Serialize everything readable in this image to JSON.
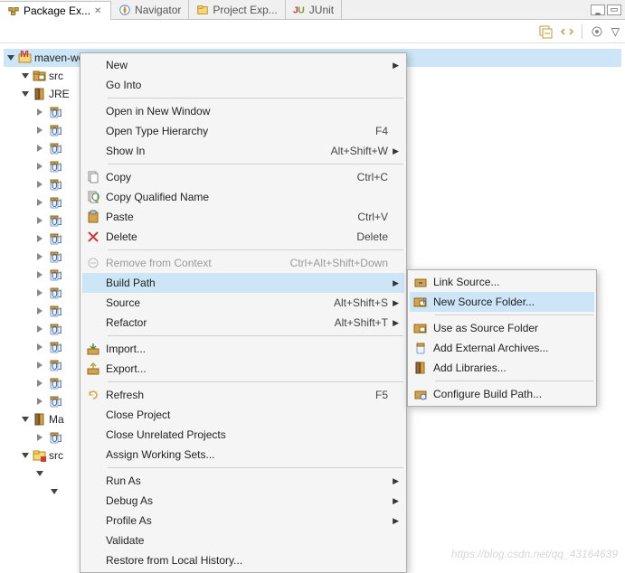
{
  "tabs": [
    {
      "label": "Package Ex...",
      "active": true
    },
    {
      "label": "Navigator",
      "active": false
    },
    {
      "label": "Project Exp...",
      "active": false
    },
    {
      "label": "JUnit",
      "active": false
    }
  ],
  "tree": {
    "root": {
      "label": "maven-web"
    },
    "folder1": {
      "label": "src"
    },
    "folder2": {
      "label": "JRE"
    },
    "mavdep": {
      "label": "Ma"
    },
    "srcfold": {
      "label": "src"
    }
  },
  "context_menu": {
    "items": [
      {
        "label": "New",
        "submenu": true
      },
      {
        "label": "Go Into"
      },
      {
        "sep": true
      },
      {
        "label": "Open in New Window"
      },
      {
        "label": "Open Type Hierarchy",
        "accel": "F4"
      },
      {
        "label": "Show In",
        "accel": "Alt+Shift+W",
        "submenu": true
      },
      {
        "sep": true
      },
      {
        "label": "Copy",
        "accel": "Ctrl+C",
        "icon": "copy"
      },
      {
        "label": "Copy Qualified Name",
        "icon": "copyq"
      },
      {
        "label": "Paste",
        "accel": "Ctrl+V",
        "icon": "paste"
      },
      {
        "label": "Delete",
        "accel": "Delete",
        "icon": "delete"
      },
      {
        "sep": true
      },
      {
        "label": "Remove from Context",
        "accel": "Ctrl+Alt+Shift+Down",
        "disabled": true,
        "icon": "remove"
      },
      {
        "label": "Build Path",
        "submenu": true,
        "selected": true
      },
      {
        "label": "Source",
        "accel": "Alt+Shift+S",
        "submenu": true
      },
      {
        "label": "Refactor",
        "accel": "Alt+Shift+T",
        "submenu": true
      },
      {
        "sep": true
      },
      {
        "label": "Import...",
        "icon": "import"
      },
      {
        "label": "Export...",
        "icon": "export"
      },
      {
        "sep": true
      },
      {
        "label": "Refresh",
        "accel": "F5",
        "icon": "refresh"
      },
      {
        "label": "Close Project"
      },
      {
        "label": "Close Unrelated Projects"
      },
      {
        "label": "Assign Working Sets..."
      },
      {
        "sep": true
      },
      {
        "label": "Run As",
        "submenu": true
      },
      {
        "label": "Debug As",
        "submenu": true
      },
      {
        "label": "Profile As",
        "submenu": true
      },
      {
        "label": "Validate"
      },
      {
        "label": "Restore from Local History..."
      }
    ]
  },
  "submenu": {
    "items": [
      {
        "label": "Link Source...",
        "icon": "link"
      },
      {
        "label": "New Source Folder...",
        "icon": "srcfolder",
        "selected": true
      },
      {
        "sep": true
      },
      {
        "label": "Use as Source Folder",
        "icon": "use"
      },
      {
        "label": "Add External Archives...",
        "icon": "jar"
      },
      {
        "label": "Add Libraries...",
        "icon": "lib"
      },
      {
        "sep": true
      },
      {
        "label": "Configure Build Path...",
        "icon": "config"
      }
    ]
  },
  "watermark": "https://blog.csdn.net/qq_43164639",
  "icons": {
    "close": "✕"
  }
}
